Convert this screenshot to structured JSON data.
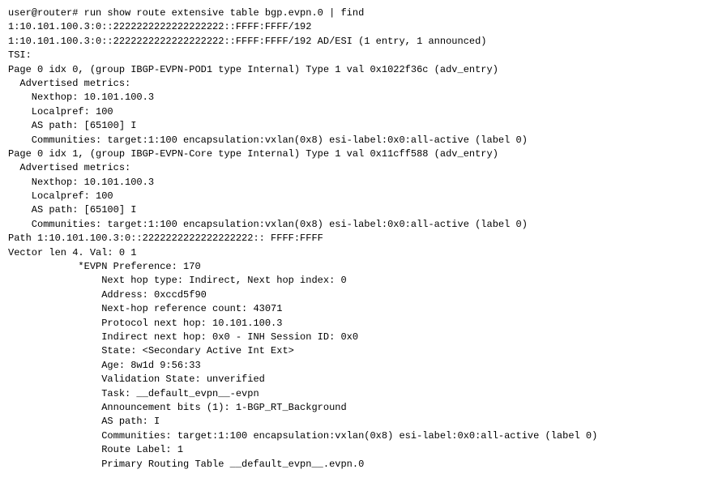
{
  "terminal": {
    "content": [
      {
        "id": "line1",
        "text": "user@router# run show route extensive table bgp.evpn.0 | find"
      },
      {
        "id": "line2",
        "text": "1:10.101.100.3:0::2222222222222222222::FFFF:FFFF/192"
      },
      {
        "id": "line3",
        "text": "1:10.101.100.3:0::2222222222222222222::FFFF:FFFF/192 AD/ESI (1 entry, 1 announced)"
      },
      {
        "id": "line4",
        "text": "TSI:"
      },
      {
        "id": "line5",
        "text": "Page 0 idx 0, (group IBGP-EVPN-POD1 type Internal) Type 1 val 0x1022f36c (adv_entry)"
      },
      {
        "id": "line6",
        "text": "  Advertised metrics:"
      },
      {
        "id": "line7",
        "text": "    Nexthop: 10.101.100.3"
      },
      {
        "id": "line8",
        "text": "    Localpref: 100"
      },
      {
        "id": "line9",
        "text": "    AS path: [65100] I"
      },
      {
        "id": "line10",
        "text": "    Communities: target:1:100 encapsulation:vxlan(0x8) esi-label:0x0:all-active (label 0)"
      },
      {
        "id": "line11",
        "text": "Page 0 idx 1, (group IBGP-EVPN-Core type Internal) Type 1 val 0x11cff588 (adv_entry)"
      },
      {
        "id": "line12",
        "text": "  Advertised metrics:"
      },
      {
        "id": "line13",
        "text": "    Nexthop: 10.101.100.3"
      },
      {
        "id": "line14",
        "text": "    Localpref: 100"
      },
      {
        "id": "line15",
        "text": "    AS path: [65100] I"
      },
      {
        "id": "line16",
        "text": "    Communities: target:1:100 encapsulation:vxlan(0x8) esi-label:0x0:all-active (label 0)"
      },
      {
        "id": "line17",
        "text": "Path 1:10.101.100.3:0::2222222222222222222:: FFFF:FFFF"
      },
      {
        "id": "line18",
        "text": "Vector len 4. Val: 0 1"
      },
      {
        "id": "line19",
        "text": "            *EVPN Preference: 170"
      },
      {
        "id": "line20",
        "text": "                Next hop type: Indirect, Next hop index: 0"
      },
      {
        "id": "line21",
        "text": "                Address: 0xccd5f90"
      },
      {
        "id": "line22",
        "text": "                Next-hop reference count: 43071"
      },
      {
        "id": "line23",
        "text": "                Protocol next hop: 10.101.100.3"
      },
      {
        "id": "line24",
        "text": "                Indirect next hop: 0x0 - INH Session ID: 0x0"
      },
      {
        "id": "line25",
        "text": "                State: <Secondary Active Int Ext>"
      },
      {
        "id": "line26",
        "text": "                Age: 8w1d 9:56:33"
      },
      {
        "id": "line27",
        "text": "                Validation State: unverified"
      },
      {
        "id": "line28",
        "text": "                Task: __default_evpn__-evpn"
      },
      {
        "id": "line29",
        "text": "                Announcement bits (1): 1-BGP_RT_Background"
      },
      {
        "id": "line30",
        "text": "                AS path: I"
      },
      {
        "id": "line31",
        "text": "                Communities: target:1:100 encapsulation:vxlan(0x8) esi-label:0x0:all-active (label 0)"
      },
      {
        "id": "line32",
        "text": "                Route Label: 1"
      },
      {
        "id": "line33",
        "text": "                Primary Routing Table __default_evpn__.evpn.0"
      }
    ]
  }
}
